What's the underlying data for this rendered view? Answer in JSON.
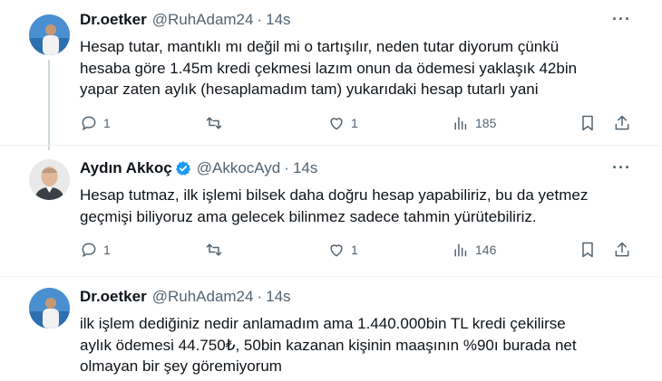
{
  "tweets": [
    {
      "name": "Dr.oetker",
      "handle": "@RuhAdam24",
      "time": "14s",
      "verified": false,
      "text_lines": [
        "Hesap tutar, mantıklı mı değil mi o tartışılır, neden tutar diyorum çünkü",
        "hesaba göre 1.45m kredi çekmesi lazım onun da ödemesi yaklaşık 42bin",
        "yapar zaten aylık (hesaplamadım tam) yukarıdaki hesap tutarlı yani"
      ],
      "replies": "1",
      "retweets": "",
      "likes": "1",
      "views": "185"
    },
    {
      "name": "Aydın Akkoç",
      "handle": "@AkkocAyd",
      "time": "14s",
      "verified": true,
      "text_lines": [
        "Hesap tutmaz, ilk işlemi bilsek daha doğru hesap yapabiliriz, bu da yetmez",
        "geçmişi biliyoruz ama gelecek bilinmez sadece tahmin yürütebiliriz."
      ],
      "replies": "1",
      "retweets": "",
      "likes": "1",
      "views": "146"
    },
    {
      "name": "Dr.oetker",
      "handle": "@RuhAdam24",
      "time": "14s",
      "verified": false,
      "text_lines": [
        "ilk işlem dediğiniz nedir anlamadım ama 1.440.000bin TL kredi çekilirse",
        "aylık ödemesi 44.750₺, 50bin kazanan kişinin maaşının %90ı burada net",
        "olmayan bir şey göremiyorum"
      ]
    }
  ],
  "dot": "·",
  "more_label": "···",
  "icons": {
    "reply": "reply-icon",
    "retweet": "retweet-icon",
    "like": "heart-icon",
    "views": "analytics-icon",
    "bookmark": "bookmark-icon",
    "share": "share-icon",
    "verified": "verified-badge-icon",
    "more": "more-options-icon"
  },
  "colors": {
    "text": "#0f1419",
    "secondary": "#536471",
    "verified": "#1d9bf0",
    "thread_line": "#cfd9de"
  }
}
